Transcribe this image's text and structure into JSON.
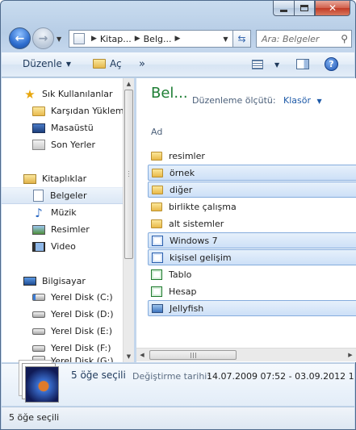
{
  "address": {
    "crumbs": [
      "Kitap...",
      "Belg..."
    ],
    "search_placeholder": "Ara: Belgeler"
  },
  "toolbar": {
    "organize": "Düzenle",
    "open": "Aç",
    "more": "»"
  },
  "navpane": {
    "favorites_header": "Sık Kullanılanlar",
    "favorites": [
      "Karşıdan Yüklem",
      "Masaüstü",
      "Son Yerler"
    ],
    "libraries_header": "Kitaplıklar",
    "libraries": [
      "Belgeler",
      "Müzik",
      "Resimler",
      "Video"
    ],
    "computer_header": "Bilgisayar",
    "drives": [
      "Yerel Disk (C:)",
      "Yerel Disk (D:)",
      "Yerel Disk (E:)",
      "Yerel Disk (F:)"
    ],
    "partial_drive": "Yerel Disk (G:)"
  },
  "content": {
    "library_title": "Bel...",
    "arrange_label": "Düzenleme ölçütü:",
    "arrange_value": "Klasör",
    "column_header": "Ad",
    "files": [
      {
        "name": "resimler",
        "type": "folder",
        "selected": false
      },
      {
        "name": "örnek",
        "type": "folder",
        "selected": true
      },
      {
        "name": "diğer",
        "type": "folder",
        "selected": true
      },
      {
        "name": "birlikte çalışma",
        "type": "folder",
        "selected": false
      },
      {
        "name": "alt sistemler",
        "type": "folder",
        "selected": false
      },
      {
        "name": "Windows 7",
        "type": "word",
        "selected": true
      },
      {
        "name": "kişisel gelişim",
        "type": "word",
        "selected": true
      },
      {
        "name": "Tablo",
        "type": "excel",
        "selected": false
      },
      {
        "name": "Hesap",
        "type": "excel",
        "selected": false
      },
      {
        "name": "Jellyfish",
        "type": "image",
        "selected": true
      }
    ]
  },
  "details": {
    "selection_count": "5 öğe seçili",
    "modified_label": "Değiştirme tarihi:",
    "modified_value": "14.07.2009 07:52 - 03.09.2012 1"
  },
  "status": {
    "text": "5 öğe seçili"
  }
}
